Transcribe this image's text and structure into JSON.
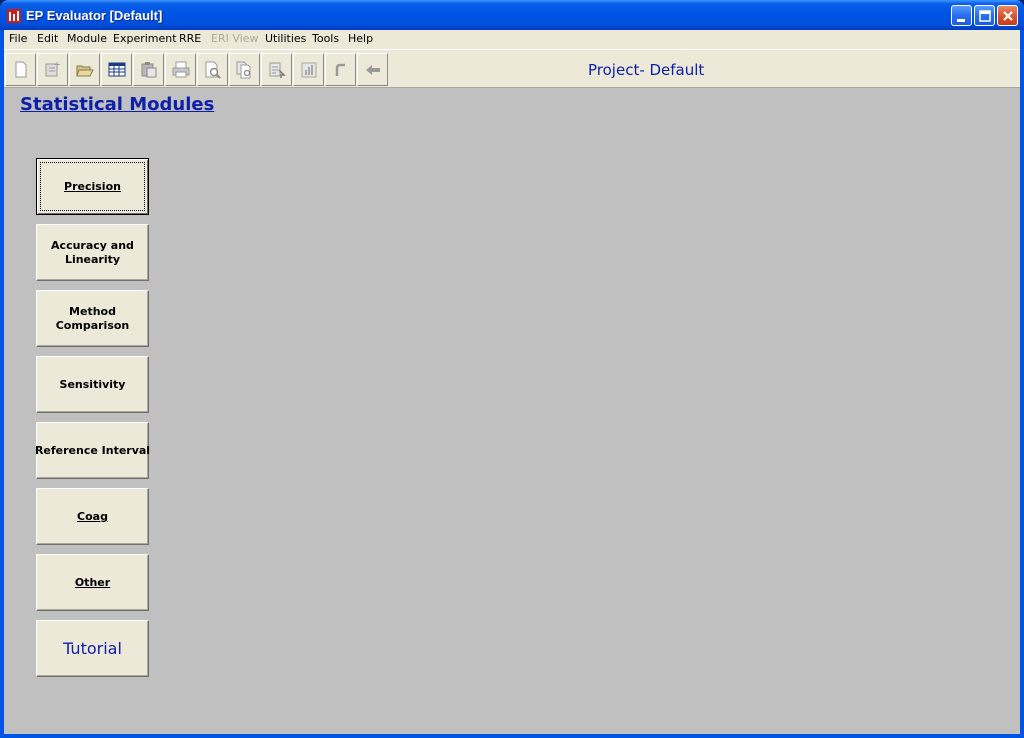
{
  "window": {
    "title": "EP Evaluator [Default]"
  },
  "menu": [
    {
      "label": "File",
      "enabled": true
    },
    {
      "label": "Edit",
      "enabled": true
    },
    {
      "label": "Module",
      "enabled": true
    },
    {
      "label": "Experiment",
      "enabled": true
    },
    {
      "label": "RRE",
      "enabled": true
    },
    {
      "label": "ERI View",
      "enabled": false
    },
    {
      "label": "Utilities",
      "enabled": true
    },
    {
      "label": "Tools",
      "enabled": true
    },
    {
      "label": "Help",
      "enabled": true
    }
  ],
  "toolbar": {
    "project_label": "Project- Default",
    "buttons": [
      "new-icon",
      "new-record-icon",
      "open-icon",
      "grid-icon",
      "paste-icon",
      "print-icon",
      "print-preview-icon",
      "copy-preview-icon",
      "report-icon",
      "chart-icon",
      "undo-icon",
      "back-arrow-icon"
    ]
  },
  "content": {
    "section_title": "Statistical Modules",
    "modules": [
      {
        "label": "Precision",
        "active": true
      },
      {
        "label": "Accuracy and Linearity"
      },
      {
        "label": "Method Comparison"
      },
      {
        "label": "Sensitivity"
      },
      {
        "label": "Reference Interval"
      },
      {
        "label": "Coag"
      },
      {
        "label": "Other"
      },
      {
        "label": "Tutorial",
        "style": "tutorial"
      }
    ]
  },
  "colors": {
    "title_blue": "#0d1fa8",
    "chrome": "#ece9d8",
    "workspace": "#c0c0c0"
  }
}
